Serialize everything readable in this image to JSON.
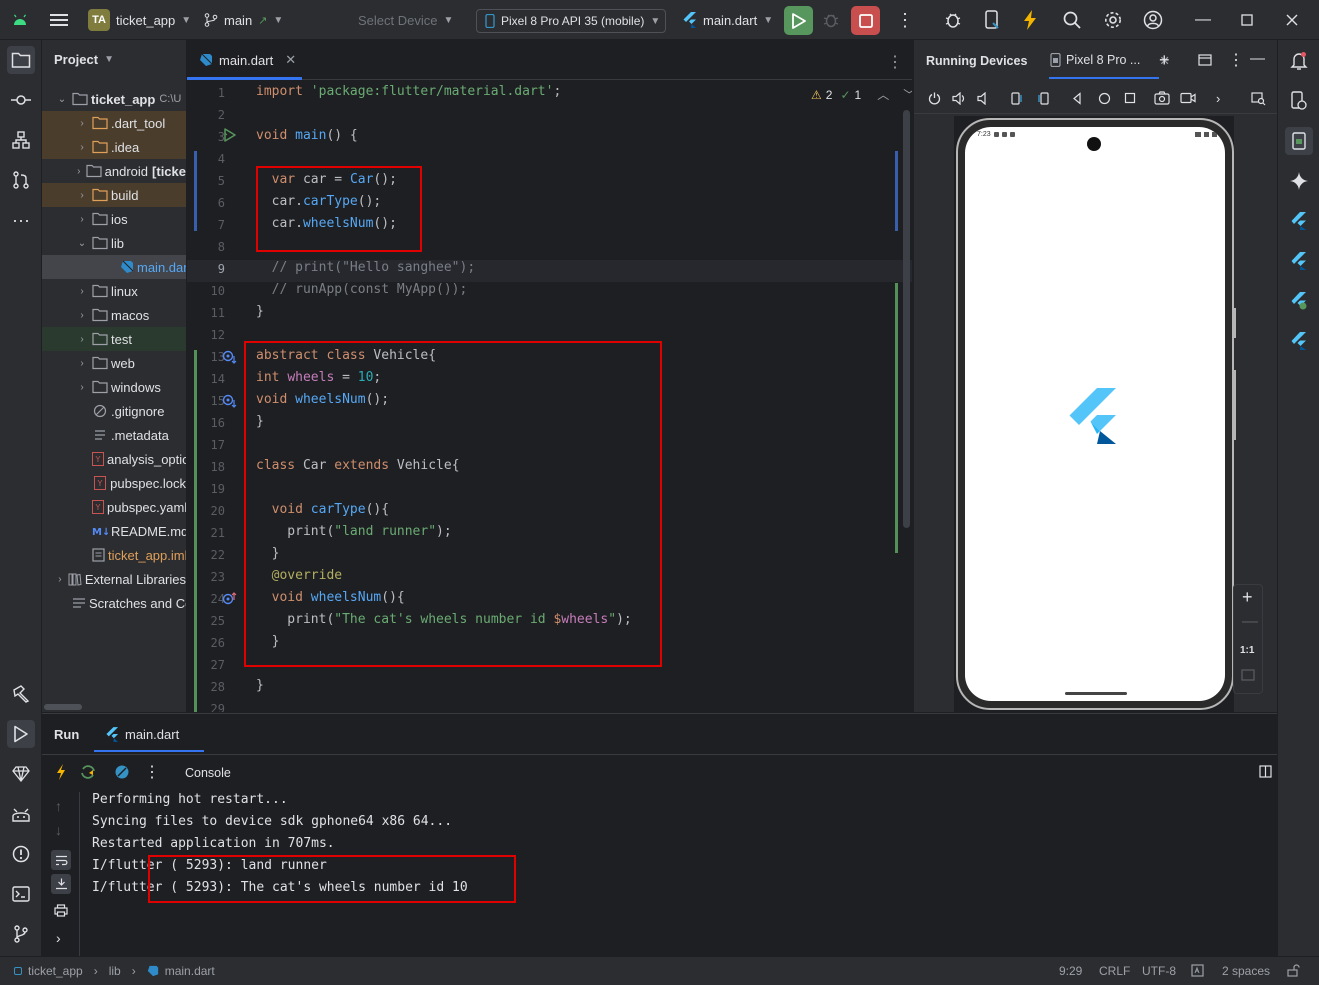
{
  "titlebar": {
    "project_badge": "TA",
    "project_name": "ticket_app",
    "branch": "main",
    "select_device": "Select Device",
    "device": "Pixel 8 Pro API 35 (mobile)",
    "run_config": "main.dart"
  },
  "project_panel": {
    "title": "Project",
    "root": "ticket_app",
    "root_path": "C:\\U",
    "items": [
      {
        "label": "dart_tool",
        "prefix": ".",
        "type": "folder-excluded"
      },
      {
        "label": "idea",
        "prefix": ".",
        "type": "folder-excluded"
      },
      {
        "label": "android",
        "suffix": "[ticke",
        "type": "folder"
      },
      {
        "label": "build",
        "type": "folder-excluded"
      },
      {
        "label": "ios",
        "type": "folder"
      },
      {
        "label": "lib",
        "type": "folder"
      },
      {
        "label": "main.dart",
        "type": "dart"
      },
      {
        "label": "linux",
        "type": "folder"
      },
      {
        "label": "macos",
        "type": "folder"
      },
      {
        "label": "test",
        "type": "folder-test"
      },
      {
        "label": "web",
        "type": "folder"
      },
      {
        "label": "windows",
        "type": "folder"
      },
      {
        "label": ".gitignore",
        "type": "ignore"
      },
      {
        "label": ".metadata",
        "type": "text"
      },
      {
        "label": "analysis_optio",
        "type": "yaml"
      },
      {
        "label": "pubspec.lock",
        "type": "yaml"
      },
      {
        "label": "pubspec.yaml",
        "type": "yaml"
      },
      {
        "label": "README.md",
        "type": "md"
      },
      {
        "label": "ticket_app.iml",
        "type": "iml"
      }
    ],
    "external_libraries": "External Libraries",
    "scratches": "Scratches and Co"
  },
  "editor": {
    "tab": "main.dart",
    "warnings": "2",
    "checks": "1",
    "line_numbers": [
      "1",
      "2",
      "3",
      "4",
      "5",
      "6",
      "7",
      "8",
      "9",
      "10",
      "11",
      "12",
      "13",
      "14",
      "15",
      "16",
      "17",
      "18",
      "19",
      "20",
      "21",
      "22",
      "23",
      "24",
      "25",
      "26",
      "27",
      "28",
      "29"
    ],
    "code": [
      {
        "n": 1,
        "t": "import 'package:flutter/material.dart';"
      },
      {
        "n": 3,
        "t": "void main() {"
      },
      {
        "n": 5,
        "t": "  var car = Car();"
      },
      {
        "n": 6,
        "t": "  car.carType();"
      },
      {
        "n": 7,
        "t": "  car.wheelsNum();"
      },
      {
        "n": 9,
        "t": "  // print(\"Hello sanghee\");"
      },
      {
        "n": 10,
        "t": "  // runApp(const MyApp());"
      },
      {
        "n": 11,
        "t": "}"
      },
      {
        "n": 13,
        "t": "abstract class Vehicle{"
      },
      {
        "n": 14,
        "t": "int wheels = 10;"
      },
      {
        "n": 15,
        "t": "void wheelsNum();"
      },
      {
        "n": 16,
        "t": "}"
      },
      {
        "n": 18,
        "t": "class Car extends Vehicle{"
      },
      {
        "n": 20,
        "t": "  void carType(){"
      },
      {
        "n": 21,
        "t": "    print(\"land runner\");"
      },
      {
        "n": 22,
        "t": "  }"
      },
      {
        "n": 23,
        "t": "  @override"
      },
      {
        "n": 24,
        "t": "  void wheelsNum(){"
      },
      {
        "n": 25,
        "t": "    print(\"The cat's wheels number id $wheels\");"
      },
      {
        "n": 26,
        "t": "  }"
      },
      {
        "n": 28,
        "t": "}"
      }
    ]
  },
  "devices": {
    "title": "Running Devices",
    "tab": "Pixel 8 Pro ...",
    "status_time": "7:23",
    "zoom_label": "1:1"
  },
  "run": {
    "title": "Run",
    "tab": "main.dart",
    "console_label": "Console",
    "lines": [
      "Performing hot restart...",
      "Syncing files to device sdk gphone64 x86 64...",
      "Restarted application in 707ms.",
      "I/flutter ( 5293): land runner",
      "I/flutter ( 5293): The cat's wheels number id 10"
    ]
  },
  "statusbar": {
    "crumbs": [
      "ticket_app",
      "lib",
      "main.dart"
    ],
    "position": "9:29",
    "line_sep": "CRLF",
    "encoding": "UTF-8",
    "indent": "2 spaces"
  },
  "colors": {
    "accent": "#3574f0",
    "run_green": "#57965c",
    "stop_red": "#c94f4f",
    "highlight_red": "#e10000"
  }
}
